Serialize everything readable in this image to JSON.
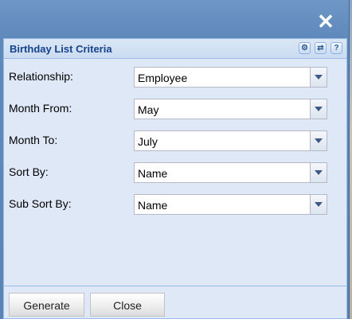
{
  "window": {
    "close_glyph": "✕"
  },
  "panel": {
    "title": "Birthday List Criteria",
    "tools": [
      {
        "icon": "gear-icon",
        "glyph": "⚙"
      },
      {
        "icon": "refresh-icon",
        "glyph": "⇄"
      },
      {
        "icon": "help-icon",
        "glyph": "?"
      }
    ]
  },
  "form": {
    "fields": [
      {
        "label": "Relationship:",
        "value": "Employee"
      },
      {
        "label": "Month From:",
        "value": "May"
      },
      {
        "label": "Month To:",
        "value": "July"
      },
      {
        "label": "Sort By:",
        "value": "Name"
      },
      {
        "label": "Sub Sort By:",
        "value": "Name"
      }
    ]
  },
  "footer": {
    "generate_label": "Generate",
    "close_label": "Close"
  }
}
